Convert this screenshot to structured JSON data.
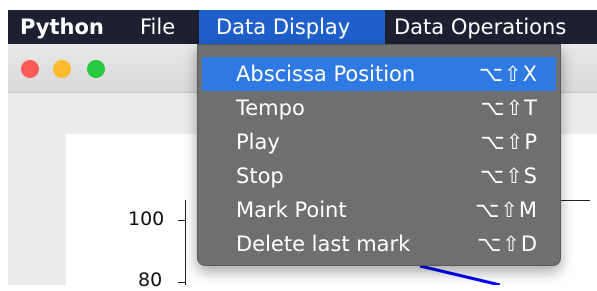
{
  "menubar": {
    "app": "Python",
    "file": "File",
    "data_display": "Data Display",
    "data_operations": "Data Operations"
  },
  "dropdown": {
    "items": [
      {
        "label": "Abscissa Position",
        "shortcut": "⌥⇧X",
        "selected": true
      },
      {
        "label": "Tempo",
        "shortcut": "⌥⇧T"
      },
      {
        "label": "Play",
        "shortcut": "⌥⇧P"
      },
      {
        "label": "Stop",
        "shortcut": "⌥⇧S"
      },
      {
        "label": "Mark Point",
        "shortcut": "⌥⇧M"
      },
      {
        "label": "Delete last mark",
        "shortcut": "⌥⇧D"
      }
    ]
  },
  "plot": {
    "yticks": [
      "100",
      "80"
    ],
    "line_color": "#0000ff"
  },
  "colors": {
    "menubar_bg": "#1d2030",
    "menu_active": "#1f5fcb",
    "item_highlight": "#2f79e3"
  }
}
